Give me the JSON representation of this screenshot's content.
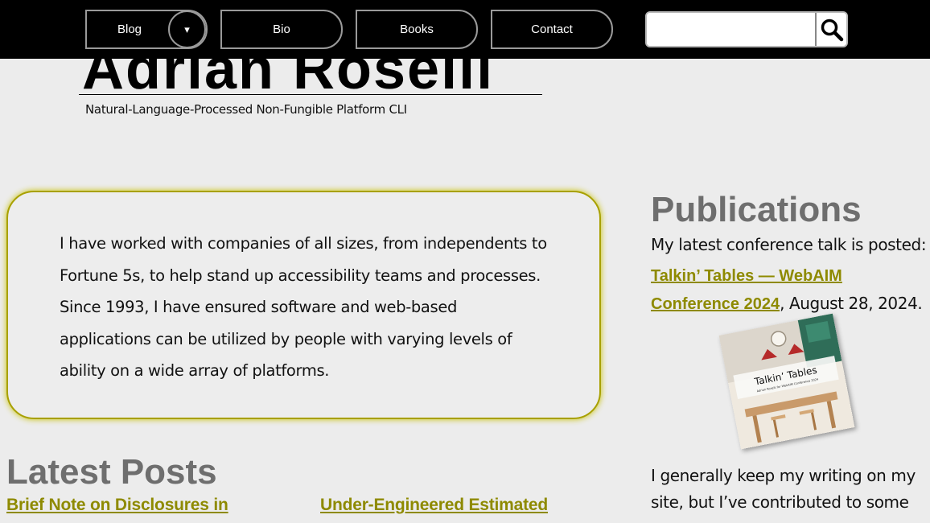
{
  "nav": {
    "blog": "Blog",
    "dropdown_icon": "▾",
    "bio": "Bio",
    "books": "Books",
    "contact": "Contact",
    "search_value": ""
  },
  "header": {
    "title": "Adrian Roselli",
    "tagline": "Natural-Language-Processed Non-Fungible Platform CLI"
  },
  "intro": {
    "text": "I have worked with companies of all sizes, from independents to Fortune 5s, to help stand up accessibility teams and processes. Since 1993, I have ensured software and web-based applications can be utilized by people with varying levels of ability on a wide array of platforms."
  },
  "latest": {
    "heading": "Latest Posts",
    "posts": [
      "Brief Note on Disclosures in",
      "Under-Engineered Estimated"
    ]
  },
  "sidebar": {
    "heading": "Publications",
    "talk_intro": "My latest conference talk is posted:",
    "talk_link": "Talkin’ Tables — WebAIM Conference 2024",
    "talk_date": ", August 28, 2024.",
    "talk_image_title": "Talkin’ Tables",
    "talk_image_subtitle": "Adrian Roselli for WebAIM Conference 2024",
    "writing_text": "I generally keep my writing on my site, but I’ve contributed to some"
  },
  "colors": {
    "accent": "#8e8a00",
    "heading_gray": "#6e6e6e",
    "topbar": "#000000",
    "background": "#ececec"
  }
}
